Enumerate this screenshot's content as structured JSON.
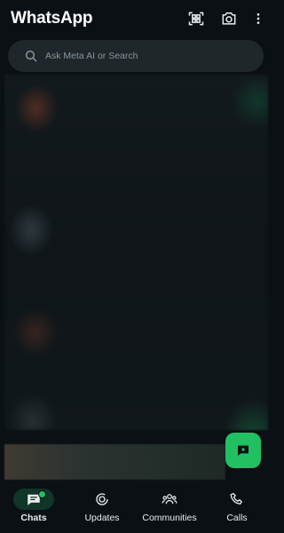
{
  "app": {
    "title": "WhatsApp"
  },
  "header": {
    "icons": [
      "qr-scan-icon",
      "camera-icon",
      "more-vert-icon"
    ]
  },
  "search": {
    "placeholder": "Ask Meta AI or Search"
  },
  "fab": {
    "icon": "new-chat-icon",
    "color": "#21c063"
  },
  "nav": {
    "items": [
      {
        "label": "Chats",
        "icon": "chats-icon",
        "active": true,
        "badge": true
      },
      {
        "label": "Updates",
        "icon": "updates-icon",
        "active": false
      },
      {
        "label": "Communities",
        "icon": "communities-icon",
        "active": false
      },
      {
        "label": "Calls",
        "icon": "calls-icon",
        "active": false
      }
    ]
  },
  "colors": {
    "background": "#0b1014",
    "accent": "#21c063",
    "search_bg": "#1f272a",
    "active_pill": "#103529"
  }
}
